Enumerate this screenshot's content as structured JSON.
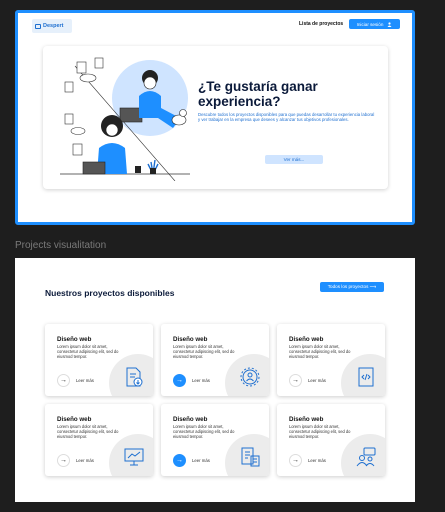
{
  "header": {
    "logo": "Despert",
    "nav_link": "Lista de proyectos",
    "login_label": "Iniciar sesión"
  },
  "hero": {
    "title": "¿Te gustaría ganar experiencia?",
    "description": "Descubre todos los proyectos disponibles para que puedas desarrollar tu experiencia laboral y ver trabajar en la empresa que desees y alcanzar tus objetivos profesionales.",
    "button": "Ver más..."
  },
  "section_label": "Projects visualitation",
  "projects": {
    "title": "Nuestros proyectos disponibles",
    "all_button": "Todos los proyectos ⟶",
    "cards": [
      {
        "title": "Diseño web",
        "text": "Lorem ipsum dolor sit amet, consectetur adipiscing elit, sed do eiusmod tempor.",
        "link": "Leer más",
        "icon": "document-download-icon",
        "active": false
      },
      {
        "title": "Diseño web",
        "text": "Lorem ipsum dolor sit amet, consectetur adipiscing elit, sed do eiusmod tempor.",
        "link": "Leer más",
        "icon": "gear-user-icon",
        "active": true
      },
      {
        "title": "Diseño web",
        "text": "Lorem ipsum dolor sit amet, consectetur adipiscing elit, sed do eiusmod tempor.",
        "link": "Leer más",
        "icon": "code-document-icon",
        "active": false
      },
      {
        "title": "Diseño web",
        "text": "Lorem ipsum dolor sit amet, consectetur adipiscing elit, sed do eiusmod tempor.",
        "link": "Leer más",
        "icon": "presentation-board-icon",
        "active": false
      },
      {
        "title": "Diseño web",
        "text": "Lorem ipsum dolor sit amet, consectetur adipiscing elit, sed do eiusmod tempor.",
        "link": "Leer más",
        "icon": "building-document-icon",
        "active": true
      },
      {
        "title": "Diseño web",
        "text": "Lorem ipsum dolor sit amet, consectetur adipiscing elit, sed do eiusmod tempor.",
        "link": "Leer más",
        "icon": "chat-users-icon",
        "active": false
      }
    ]
  },
  "colors": {
    "accent": "#1e8fff",
    "dark_text": "#0b1a3a",
    "soft_blue": "#cfe4ff"
  }
}
